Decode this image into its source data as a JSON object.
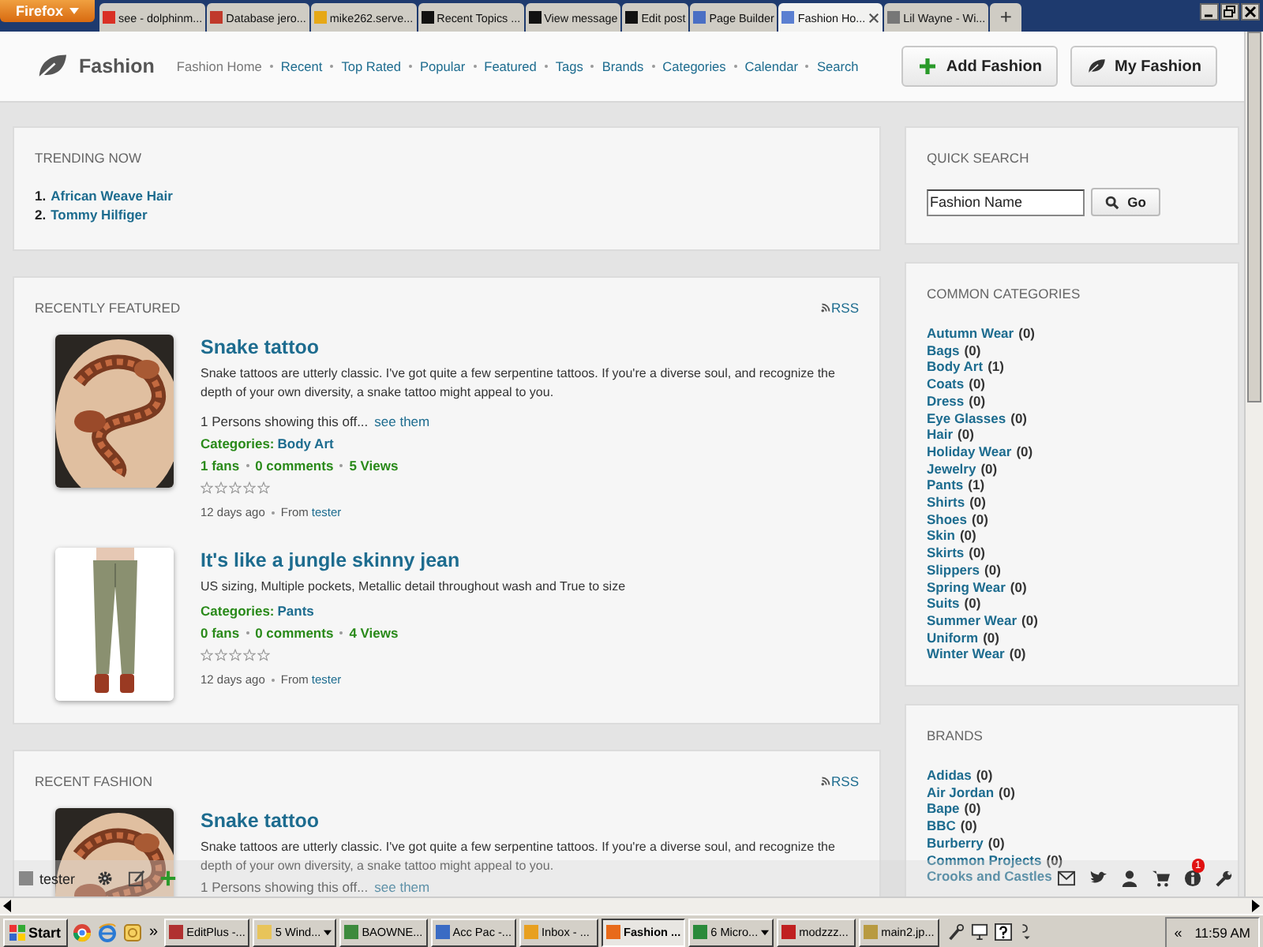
{
  "browser": {
    "menu_button": "Firefox",
    "new_tab": "+",
    "tabs": [
      {
        "title": "see - dolphinm...",
        "color": "#d93025",
        "selected": false
      },
      {
        "title": "Database jero...",
        "color": "#c0392b",
        "selected": false
      },
      {
        "title": "mike262.serve...",
        "color": "#e6a817",
        "selected": false
      },
      {
        "title": "Recent Topics ...",
        "color": "#111111",
        "selected": false
      },
      {
        "title": "View message",
        "color": "#111111",
        "selected": false
      },
      {
        "title": "Edit post",
        "color": "#111111",
        "selected": false
      },
      {
        "title": "Page Builder",
        "color": "#4a6fc4",
        "selected": false
      },
      {
        "title": "Fashion Ho...",
        "color": "#5b7fd1",
        "selected": true
      },
      {
        "title": "Lil Wayne - Wi...",
        "color": "#777777",
        "selected": false
      }
    ]
  },
  "header": {
    "site_name": "Fashion",
    "nav": [
      {
        "label": "Fashion Home",
        "selected": true
      },
      {
        "label": "Recent",
        "selected": false
      },
      {
        "label": "Top Rated",
        "selected": false
      },
      {
        "label": "Popular",
        "selected": false
      },
      {
        "label": "Featured",
        "selected": false
      },
      {
        "label": "Tags",
        "selected": false
      },
      {
        "label": "Brands",
        "selected": false
      },
      {
        "label": "Categories",
        "selected": false
      },
      {
        "label": "Calendar",
        "selected": false
      },
      {
        "label": "Search",
        "selected": false
      }
    ],
    "buttons": [
      {
        "label": "Add Fashion",
        "kind": "add"
      },
      {
        "label": "My Fashion",
        "kind": "mine"
      }
    ]
  },
  "trending": {
    "title": "TRENDING NOW",
    "items": [
      {
        "rank": "1.",
        "label": "African Weave Hair"
      },
      {
        "rank": "2.",
        "label": "Tommy Hilfiger"
      }
    ]
  },
  "featured": {
    "title": "RECENTLY FEATURED",
    "rss": "RSS",
    "items": [
      {
        "kind": "picture",
        "title": "Snake tattoo",
        "description": "Snake tattoos are utterly classic. I've got quite a few serpentine tattoos. If you're a diverse soul, and recognize the depth of your own diversity, a snake tattoo might appeal to you.",
        "showing": "1 Persons showing this off...",
        "see_link": "see them",
        "categories_label": "Categories:",
        "category": "Body Art",
        "fans": "1 fans",
        "comments": "0 comments",
        "views": "5 Views",
        "stars": 0,
        "age": "12 days ago",
        "from_label": "From",
        "author": "tester"
      },
      {
        "kind": "picture",
        "title": "It's like a jungle skinny jean",
        "description": "US sizing, Multiple pockets, Metallic detail throughout wash and True to size",
        "categories_label": "Categories:",
        "category": "Pants",
        "fans": "0 fans",
        "comments": "0 comments",
        "views": "4 Views",
        "stars": 0,
        "age": "12 days ago",
        "from_label": "From",
        "author": "tester"
      }
    ]
  },
  "recent": {
    "title": "RECENT FASHION",
    "rss": "RSS",
    "items": [
      {
        "kind": "picture",
        "title": "Snake tattoo",
        "description": "Snake tattoos are utterly classic. I've got quite a few serpentine tattoos. If you're a diverse soul, and recognize the depth of your own diversity, a snake tattoo might appeal to you.",
        "showing": "1 Persons showing this off...",
        "see_link": "see them"
      }
    ]
  },
  "quick_search": {
    "title": "QUICK SEARCH",
    "value": "Fashion Name",
    "button": "Go"
  },
  "categories": {
    "title": "COMMON CATEGORIES",
    "items": [
      {
        "name": "Autumn Wear",
        "count": "(0)"
      },
      {
        "name": "Bags",
        "count": "(0)"
      },
      {
        "name": "Body Art",
        "count": "(1)"
      },
      {
        "name": "Coats",
        "count": "(0)"
      },
      {
        "name": "Dress",
        "count": "(0)"
      },
      {
        "name": "Eye Glasses",
        "count": "(0)"
      },
      {
        "name": "Hair",
        "count": "(0)"
      },
      {
        "name": "Holiday Wear",
        "count": "(0)"
      },
      {
        "name": "Jewelry",
        "count": "(0)"
      },
      {
        "name": "Pants",
        "count": "(1)"
      },
      {
        "name": "Shirts",
        "count": "(0)"
      },
      {
        "name": "Shoes",
        "count": "(0)"
      },
      {
        "name": "Skin",
        "count": "(0)"
      },
      {
        "name": "Skirts",
        "count": "(0)"
      },
      {
        "name": "Slippers",
        "count": "(0)"
      },
      {
        "name": "Spring Wear",
        "count": "(0)"
      },
      {
        "name": "Suits",
        "count": "(0)"
      },
      {
        "name": "Summer Wear",
        "count": "(0)"
      },
      {
        "name": "Uniform",
        "count": "(0)"
      },
      {
        "name": "Winter Wear",
        "count": "(0)"
      }
    ]
  },
  "brands": {
    "title": "BRANDS",
    "items": [
      {
        "name": "Adidas",
        "count": "(0)"
      },
      {
        "name": "Air Jordan",
        "count": "(0)"
      },
      {
        "name": "Bape",
        "count": "(0)"
      },
      {
        "name": "BBC",
        "count": "(0)"
      },
      {
        "name": "Burberry",
        "count": "(0)"
      },
      {
        "name": "Common Projects",
        "count": "(0)"
      },
      {
        "name": "Crooks and Castles"
      }
    ]
  },
  "toolbar": {
    "user": "tester",
    "badge": "1"
  },
  "taskbar": {
    "start": "Start",
    "more": "»",
    "tray_more": "«",
    "clock": "11:59 AM",
    "buttons": [
      {
        "label": "EditPlus -...",
        "color": "#b03030",
        "selected": false,
        "menu": false
      },
      {
        "label": "5 Wind...",
        "color": "#e8c45a",
        "selected": false,
        "menu": true
      },
      {
        "label": "BAOWNE...",
        "color": "#3d8a3d",
        "selected": false,
        "menu": false
      },
      {
        "label": "Acc Pac -...",
        "color": "#3a6bc4",
        "selected": false,
        "menu": false
      },
      {
        "label": "Inbox - ...",
        "color": "#e8a020",
        "selected": false,
        "menu": false
      },
      {
        "label": "Fashion ...",
        "color": "#e86a1a",
        "selected": true,
        "menu": false
      },
      {
        "label": "6 Micro...",
        "color": "#2a8a3a",
        "selected": false,
        "menu": true
      },
      {
        "label": "modzzz...",
        "color": "#c02020",
        "selected": false,
        "menu": false
      },
      {
        "label": "main2.jp...",
        "color": "#b89a40",
        "selected": false,
        "menu": false
      }
    ]
  }
}
